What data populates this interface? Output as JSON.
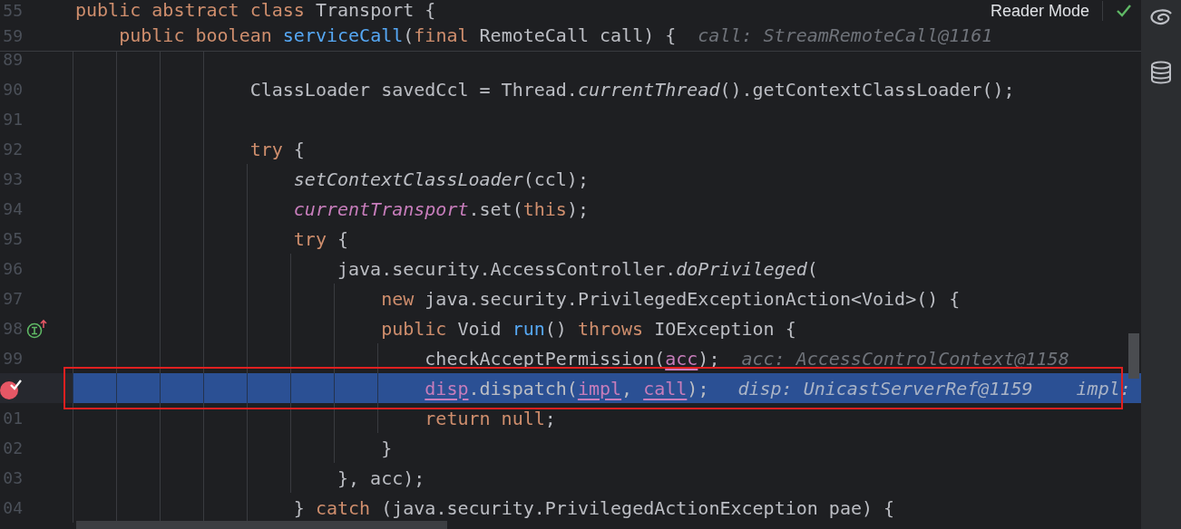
{
  "sticky_lines": [
    {
      "number": "55",
      "tokens": [
        {
          "text": "public ",
          "kind": "kw"
        },
        {
          "text": "abstract ",
          "kind": "kw"
        },
        {
          "text": "class",
          "kind": "kw"
        },
        {
          "text": " Transport {",
          "kind": "plain"
        }
      ]
    },
    {
      "number": "59",
      "tokens": [
        {
          "text": "    public ",
          "kind": "kw"
        },
        {
          "text": "boolean ",
          "kind": "kw"
        },
        {
          "text": "serviceCall",
          "kind": "fn"
        },
        {
          "text": "(",
          "kind": "plain"
        },
        {
          "text": "final",
          "kind": "kw"
        },
        {
          "text": " RemoteCall call) {",
          "kind": "plain"
        }
      ],
      "hints": [
        "call: StreamRemoteCall@1161"
      ]
    }
  ],
  "lines": [
    {
      "number": "89",
      "breakpoint": false,
      "implements_marker": false,
      "current": false
    },
    {
      "number": "90",
      "breakpoint": false,
      "implements_marker": false,
      "current": false,
      "tokens": [
        {
          "text": "                ClassLoader savedCcl = Thread.",
          "kind": "plain"
        },
        {
          "text": "currentThread",
          "kind": "static"
        },
        {
          "text": "().getContextClassLoader();",
          "kind": "plain"
        }
      ]
    },
    {
      "number": "91",
      "breakpoint": false,
      "implements_marker": false,
      "current": false
    },
    {
      "number": "92",
      "breakpoint": false,
      "implements_marker": false,
      "current": false,
      "tokens": [
        {
          "text": "                try",
          "kind": "kw"
        },
        {
          "text": " {",
          "kind": "plain"
        }
      ]
    },
    {
      "number": "93",
      "breakpoint": false,
      "implements_marker": false,
      "current": false,
      "tokens": [
        {
          "text": "                    setContextClassLoader",
          "kind": "static"
        },
        {
          "text": "(ccl);",
          "kind": "plain"
        }
      ]
    },
    {
      "number": "94",
      "breakpoint": false,
      "implements_marker": false,
      "current": false,
      "tokens": [
        {
          "text": "                    currentTransport",
          "kind": "field"
        },
        {
          "text": ".set(",
          "kind": "plain"
        },
        {
          "text": "this",
          "kind": "kw"
        },
        {
          "text": ");",
          "kind": "plain"
        }
      ]
    },
    {
      "number": "95",
      "breakpoint": false,
      "implements_marker": false,
      "current": false,
      "tokens": [
        {
          "text": "                    try",
          "kind": "kw"
        },
        {
          "text": " {",
          "kind": "plain"
        }
      ]
    },
    {
      "number": "96",
      "breakpoint": false,
      "implements_marker": false,
      "current": false,
      "tokens": [
        {
          "text": "                        java.security.AccessController.",
          "kind": "plain"
        },
        {
          "text": "doPrivileged",
          "kind": "static"
        },
        {
          "text": "(",
          "kind": "plain"
        }
      ]
    },
    {
      "number": "97",
      "breakpoint": false,
      "implements_marker": false,
      "current": false,
      "tokens": [
        {
          "text": "                            new",
          "kind": "kw"
        },
        {
          "text": " java.security.PrivilegedExceptionAction<Void>() {",
          "kind": "plain"
        }
      ]
    },
    {
      "number": "98",
      "breakpoint": false,
      "implements_marker": true,
      "current": false,
      "tokens": [
        {
          "text": "                            public",
          "kind": "kw"
        },
        {
          "text": " Void ",
          "kind": "plain"
        },
        {
          "text": "run",
          "kind": "fn"
        },
        {
          "text": "() ",
          "kind": "plain"
        },
        {
          "text": "throws",
          "kind": "kw"
        },
        {
          "text": " IOException {",
          "kind": "plain"
        }
      ]
    },
    {
      "number": "99",
      "breakpoint": false,
      "implements_marker": false,
      "current": false,
      "tokens": [
        {
          "text": "                                checkAcceptPermission(",
          "kind": "plain"
        },
        {
          "text": "acc",
          "kind": "param"
        },
        {
          "text": ");",
          "kind": "plain"
        }
      ],
      "hints": [
        "acc: AccessControlContext@1158"
      ]
    },
    {
      "breakpoint": true,
      "implements_marker": false,
      "current": true,
      "tokens": [
        {
          "text": "                                disp",
          "kind": "param"
        },
        {
          "text": ".dispatch(",
          "kind": "plain"
        },
        {
          "text": "impl",
          "kind": "param"
        },
        {
          "text": ", ",
          "kind": "plain"
        },
        {
          "text": "call",
          "kind": "param"
        },
        {
          "text": ");",
          "kind": "plain"
        }
      ],
      "hints": [
        "disp: UnicastServerRef@1159",
        "impl:"
      ]
    },
    {
      "number": "01",
      "breakpoint": false,
      "implements_marker": false,
      "current": false,
      "tokens": [
        {
          "text": "                                return ",
          "kind": "kw"
        },
        {
          "text": "null",
          "kind": "kw"
        },
        {
          "text": ";",
          "kind": "plain"
        }
      ]
    },
    {
      "number": "02",
      "breakpoint": false,
      "implements_marker": false,
      "current": false,
      "tokens": [
        {
          "text": "                            }",
          "kind": "plain"
        }
      ]
    },
    {
      "number": "03",
      "breakpoint": false,
      "implements_marker": false,
      "current": false,
      "tokens": [
        {
          "text": "                        }, acc);",
          "kind": "plain"
        }
      ]
    },
    {
      "number": "04",
      "breakpoint": false,
      "implements_marker": false,
      "current": false,
      "tokens": [
        {
          "text": "                    } ",
          "kind": "plain"
        },
        {
          "text": "catch",
          "kind": "kw"
        },
        {
          "text": " (java.security.PrivilegedActionException pae) {",
          "kind": "plain"
        }
      ]
    }
  ],
  "reader_mode": {
    "label": "Reader Mode"
  }
}
